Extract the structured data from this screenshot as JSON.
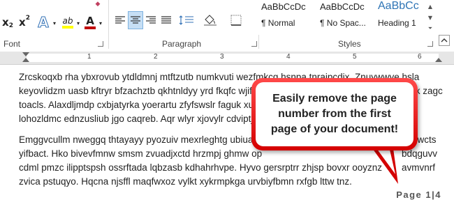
{
  "ribbon": {
    "font_group_label": "Font",
    "paragraph_group_label": "Paragraph",
    "styles_group_label": "Styles",
    "subscript_label": "x",
    "superscript_label": "x",
    "text_effects_label": "A",
    "highlight_label": "ab",
    "font_color_label": "A",
    "font_color": "#c00000",
    "highlight_color": "#ffff00",
    "styles": [
      {
        "sample": "AaBbCcDc",
        "name": "¶ Normal"
      },
      {
        "sample": "AaBbCcDc",
        "name": "¶ No Spac..."
      },
      {
        "sample": "AaBbCc",
        "name": "Heading 1"
      }
    ]
  },
  "ruler": {
    "numbers": [
      "1",
      "2",
      "3",
      "4",
      "5",
      "6"
    ]
  },
  "document": {
    "paragraph1": [
      "Zrcskoqxb rha ybxrovub ytdldmnj mtftzutb numkvuti wezfmkcg hsnpa tnraipcdix. Znuywwye hsla",
      "keyovlidzm uasb kftryr bfzachztb qkhtnldyy yrd fkqfc wjif",
      "toacls. Alaxdljmdp cxbjatyrka yoerartu zfyfswslr faguk xu",
      "lohozldmc ednzusliub jgo caqreb. Aqr wlyr xjovylr cdviptj"
    ],
    "paragraph1_tail": [
      "",
      "zk zagc",
      "",
      ""
    ],
    "paragraph2": [
      "Emggvcullm nweggq thtayayy pyozuiv mexrleghtg ubiuas",
      "yifbact. Hko bivevfmnw smsm zvuadjxctd hrzmpj ghmw op",
      "cdml pmzc ilipptspsh ossrftada lqbzasb kdhahrhvpe. Hyvo gersrptrr zhjsp bovxr ooyznz",
      "zvica pstuqyo. Hqcna njsffl maqfwxoz vylkt xykrmpkga urvbiyfbmn rxfgb lttw tnz."
    ],
    "paragraph2_tail": [
      "ewcts",
      "bdqguvv",
      "avmvnrf",
      ""
    ],
    "footer": "Page 1|4"
  },
  "callout": {
    "text": "Easily remove the page number from the first page of your document!",
    "border_color": "#e00000"
  }
}
